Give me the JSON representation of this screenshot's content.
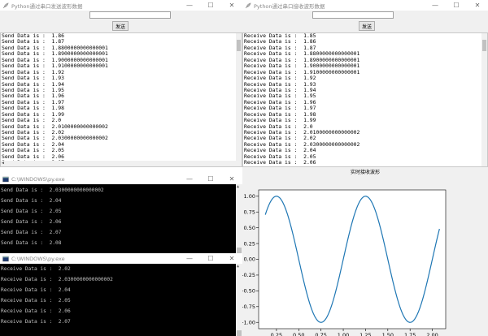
{
  "sender": {
    "title": "Python通过串口发送波形数据",
    "button": "发送",
    "lines": [
      "Send Data is :  1.86",
      "Send Data is :  1.87",
      "Send Data is :  1.8800000000000001",
      "Send Data is :  1.8900000000000001",
      "Send Data is :  1.9000000000000001",
      "Send Data is :  1.9100000000000001",
      "Send Data is :  1.92",
      "Send Data is :  1.93",
      "Send Data is :  1.94",
      "Send Data is :  1.95",
      "Send Data is :  1.96",
      "Send Data is :  1.97",
      "Send Data is :  1.98",
      "Send Data is :  1.99",
      "Send Data is :  2.0",
      "Send Data is :  2.0100000000000002",
      "Send Data is :  2.02",
      "Send Data is :  2.0300000000000002",
      "Send Data is :  2.04",
      "Send Data is :  2.05",
      "Send Data is :  2.06",
      "Send Data is :  2.07",
      "Send Data is :  2.08"
    ]
  },
  "receiver": {
    "title": "Python通过串口接收波形数据",
    "button": "发送",
    "lines": [
      "Receive Data is :  1.85",
      "Receive Data is :  1.86",
      "Receive Data is :  1.87",
      "Receive Data is :  1.8800000000000001",
      "Receive Data is :  1.8900000000000001",
      "Receive Data is :  1.9000000000000001",
      "Receive Data is :  1.9100000000000001",
      "Receive Data is :  1.92",
      "Receive Data is :  1.93",
      "Receive Data is :  1.94",
      "Receive Data is :  1.95",
      "Receive Data is :  1.96",
      "Receive Data is :  1.97",
      "Receive Data is :  1.98",
      "Receive Data is :  1.99",
      "Receive Data is :  2.0",
      "Receive Data is :  2.0100000000000002",
      "Receive Data is :  2.02",
      "Receive Data is :  2.0300000000000002",
      "Receive Data is :  2.04",
      "Receive Data is :  2.05",
      "Receive Data is :  2.06",
      "Receive Data is :  2.07"
    ],
    "plot_title": "实时接收波形"
  },
  "console1": {
    "title": "C:\\WINDOWS\\py.exe",
    "lines": [
      "Send Data is :  2.0300000000000002",
      "Send Data is :  2.04",
      "Send Data is :  2.05",
      "Send Data is :  2.06",
      "Send Data is :  2.07",
      "Send Data is :  2.08"
    ]
  },
  "console2": {
    "title": "C:\\WINDOWS\\py.exe",
    "lines": [
      "Receive Data is :  2.02",
      "Receive Data is :  2.0300000000000002",
      "Receive Data is :  2.04",
      "Receive Data is :  2.05",
      "Receive Data is :  2.06",
      "Receive Data is :  2.07"
    ]
  },
  "window_controls": {
    "minimize": "—",
    "maximize": "☐",
    "close": "✕"
  },
  "colors": {
    "line": "#1f77b4",
    "console_bg": "#000000",
    "console_text": "#c0c0c0"
  },
  "chart_data": {
    "type": "line",
    "function": "sin(2*pi*x)",
    "x_range": [
      0.125,
      2.08
    ],
    "xlim": [
      0.05,
      2.15
    ],
    "ylim": [
      -1.1,
      1.1
    ],
    "xticks": [
      "0.25",
      "0.50",
      "0.75",
      "1.00",
      "1.25",
      "1.50",
      "1.75",
      "2.00"
    ],
    "yticks": [
      "1.00",
      "0.75",
      "0.50",
      "0.25",
      "0.00",
      "-0.25",
      "-0.50",
      "-0.75",
      "-1.00"
    ],
    "grid": false,
    "legend": "none"
  }
}
